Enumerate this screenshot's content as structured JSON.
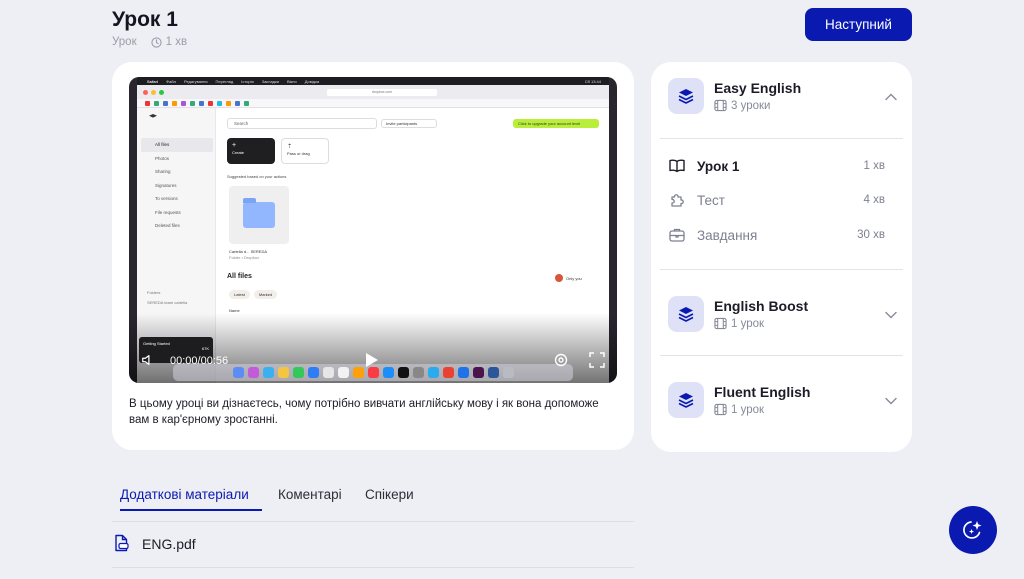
{
  "lesson": {
    "title": "Урок 1",
    "type": "Урок",
    "duration": "1 хв",
    "description": "В цьому уроці ви дізнаєтесь, чому потрібно вивчати англійську мову і як вона допоможе вам в кар'єрному зростанні."
  },
  "header": {
    "next_label": "Наступний"
  },
  "video": {
    "time": "00:00/00:56",
    "screen": {
      "menu": [
        "Safari",
        "Файл",
        "Редагування",
        "Перегляд",
        "Історія",
        "Закладки",
        "Вікно",
        "Довідка"
      ],
      "clock": "Сб 13:44",
      "url": "dropbox.com",
      "sidebar": [
        "All files",
        "Photos",
        "Sharing",
        "Signatures",
        "To versions",
        "File requests",
        "Deleted files"
      ],
      "folders_label": "Folders",
      "folder_item": "SEREDA team cartella",
      "search_placeholder": "Search",
      "invite": "Invite participants",
      "upgrade": "Click to upgrade your account level",
      "create": "Create",
      "drop": "Pass or drag",
      "suggested": "Suggested based on your actions",
      "folder_name": "Cartella d... SEREDA",
      "folder_sub": "Folder • Dropbox",
      "all_files": "All files",
      "chip_latest": "Latest",
      "chip_marked": "Marked",
      "name_col": "Name",
      "only_you": "Only you",
      "getting_started": "Getting Started",
      "getting_size": "67K"
    }
  },
  "courses": [
    {
      "name": "Easy English",
      "count": "3 уроки",
      "expanded": true,
      "lessons": [
        {
          "name": "Урок 1",
          "duration": "1 хв",
          "icon": "book-open-icon",
          "current": true
        },
        {
          "name": "Тест",
          "duration": "4 хв",
          "icon": "puzzle-icon",
          "current": false
        },
        {
          "name": "Завдання",
          "duration": "30 хв",
          "icon": "briefcase-icon",
          "current": false
        }
      ]
    },
    {
      "name": "English Boost",
      "count": "1 урок",
      "expanded": false
    },
    {
      "name": "Fluent English",
      "count": "1 урок",
      "expanded": false
    }
  ],
  "tabs": [
    {
      "label": "Додаткові матеріали",
      "active": true
    },
    {
      "label": "Коментарі",
      "active": false
    },
    {
      "label": "Спікери",
      "active": false
    }
  ],
  "files": [
    {
      "name": "ENG.pdf",
      "icon": "pdf-file-icon"
    }
  ],
  "colors": {
    "accent": "#0a1ab0",
    "background": "#eeeff4",
    "course_icon_bg": "#dfe1f6",
    "muted": "#878a99"
  },
  "fab": {
    "icon": "ai-sparkle-icon"
  }
}
